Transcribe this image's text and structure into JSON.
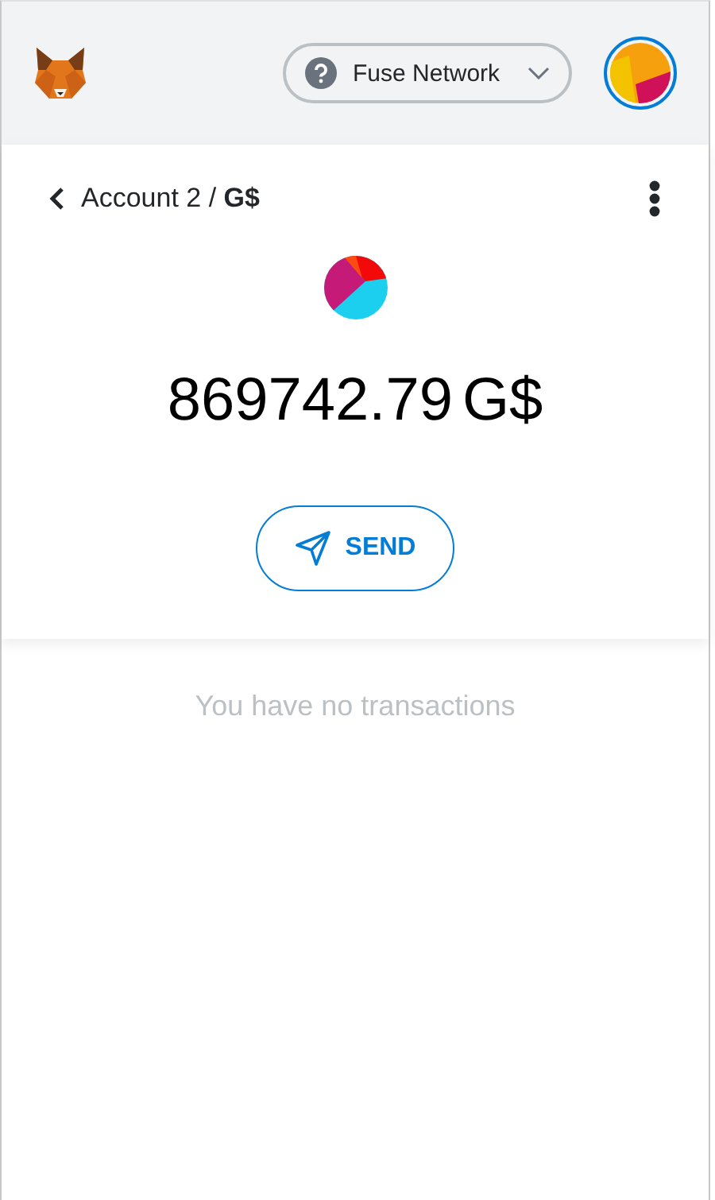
{
  "header": {
    "network": "Fuse Network"
  },
  "breadcrumb": "Account 2 / **G$**",
  "balance": {
    "amount": "869742.79",
    "symbol": "G$"
  },
  "send_button": "SEND",
  "transactions": {
    "empty_message": "You have no transactions"
  }
}
